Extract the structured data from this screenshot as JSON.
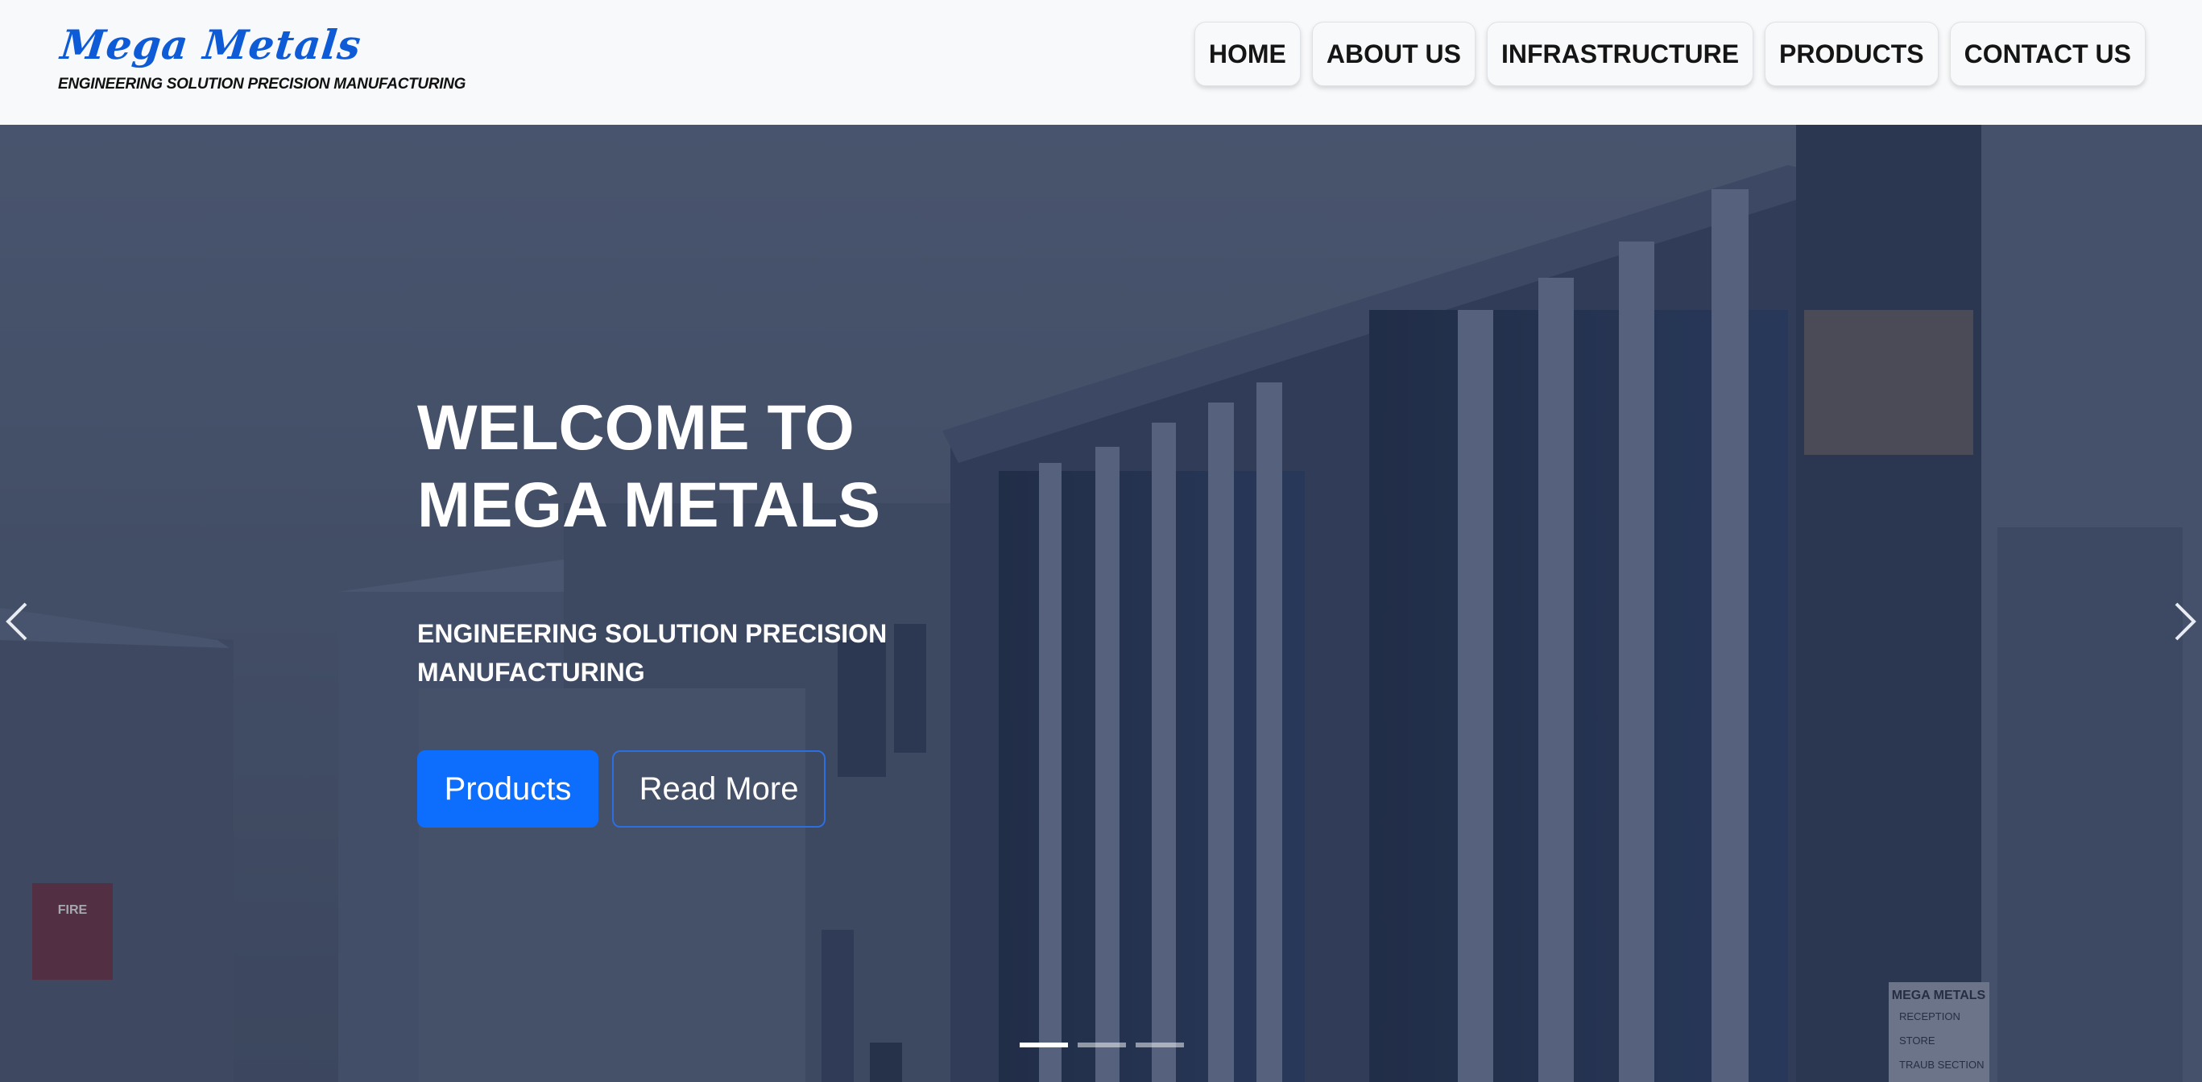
{
  "brand": {
    "name": "Mega Metals",
    "tagline": "ENGINEERING SOLUTION PRECISION MANUFACTURING",
    "color": "#0d5bd7"
  },
  "nav": {
    "items": [
      {
        "label": "HOME"
      },
      {
        "label": "ABOUT US"
      },
      {
        "label": "INFRASTRUCTURE"
      },
      {
        "label": "PRODUCTS"
      },
      {
        "label": "CONTACT US"
      }
    ]
  },
  "hero": {
    "title": "WELCOME TO MEGA METALS",
    "subtitle": "ENGINEERING SOLUTION PRECISION MANUFACTURING",
    "primary_button": "Products",
    "secondary_button": "Read More",
    "sign_fire": "FIRE",
    "sign_building": "MEGA METALS",
    "sign_directions": [
      "RECEPTION",
      "STORE",
      "TRAUB SECTION"
    ],
    "active_slide": 1,
    "slide_count": 3
  },
  "icons": {
    "prev": "chevron-left-icon",
    "next": "chevron-right-icon"
  },
  "colors": {
    "primary": "#0d6efd",
    "header_bg": "#f8f9fa"
  }
}
